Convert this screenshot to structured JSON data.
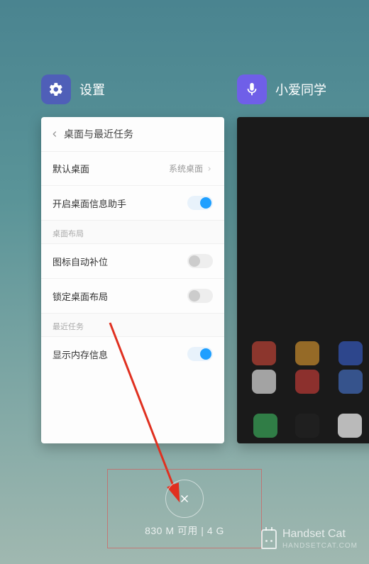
{
  "apps": {
    "settings": {
      "title": "设置"
    },
    "xiaoai": {
      "title": "小爱同学"
    }
  },
  "settings_page": {
    "header": "桌面与最近任务",
    "rows": {
      "default_launcher": {
        "label": "默认桌面",
        "value": "系统桌面"
      },
      "info_assistant": {
        "label": "开启桌面信息助手",
        "on": true
      }
    },
    "section_layout": "桌面布局",
    "rows2": {
      "auto_fill": {
        "label": "图标自动补位",
        "on": false
      },
      "lock_layout": {
        "label": "锁定桌面布局",
        "on": false
      }
    },
    "section_recent": "最近任务",
    "rows3": {
      "show_mem": {
        "label": "显示内存信息",
        "on": true
      }
    }
  },
  "memory": {
    "text": "830 M 可用 | 4 G"
  },
  "watermark": {
    "name": "Handset Cat",
    "sub": "HANDSETCAT.COM"
  }
}
